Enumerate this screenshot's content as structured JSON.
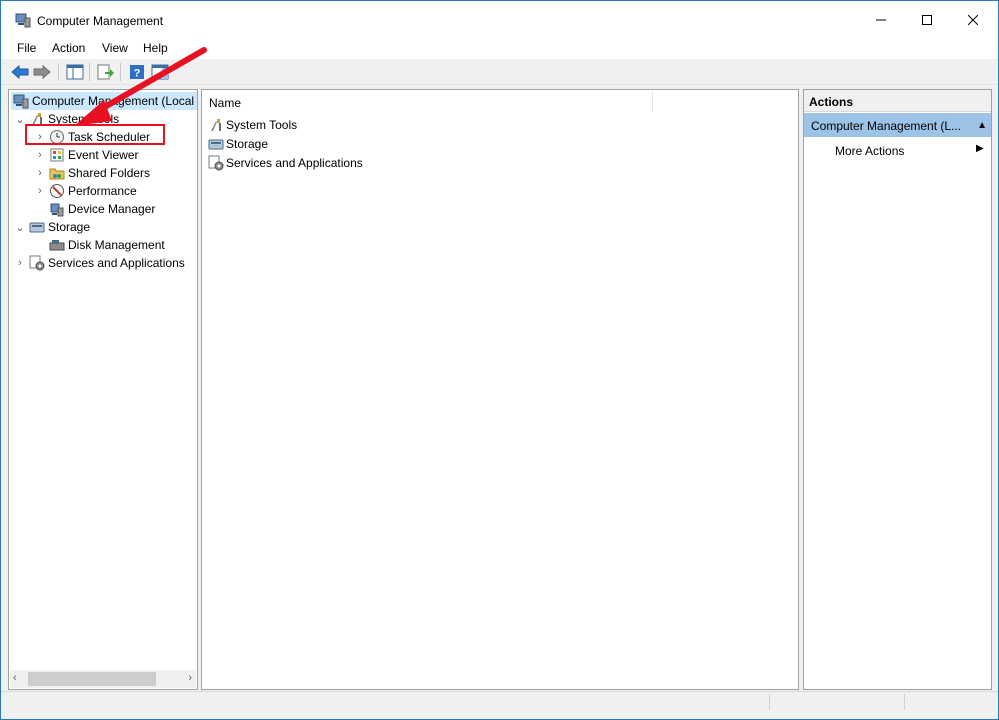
{
  "window": {
    "title": "Computer Management",
    "controls": {
      "minimize": "—",
      "maximize": "☐",
      "close": "✕"
    }
  },
  "menu": [
    "File",
    "Action",
    "View",
    "Help"
  ],
  "toolbar": {
    "buttons": [
      "back-icon",
      "forward-icon",
      "show-hide-console-tree-icon",
      "export-list-icon",
      "help-icon",
      "show-hide-action-pane-icon"
    ]
  },
  "tree": {
    "root": "Computer Management (Local",
    "system_tools": "System Tools",
    "task_scheduler": "Task Scheduler",
    "event_viewer": "Event Viewer",
    "shared_folders": "Shared Folders",
    "performance": "Performance",
    "device_manager": "Device Manager",
    "storage": "Storage",
    "disk_management": "Disk Management",
    "services_apps": "Services and Applications"
  },
  "content": {
    "column_name": "Name",
    "items": [
      "System Tools",
      "Storage",
      "Services and Applications"
    ]
  },
  "actions": {
    "header": "Actions",
    "group": "Computer Management (L...",
    "more_actions": "More Actions"
  },
  "annotation": {
    "color": "#e81123"
  }
}
